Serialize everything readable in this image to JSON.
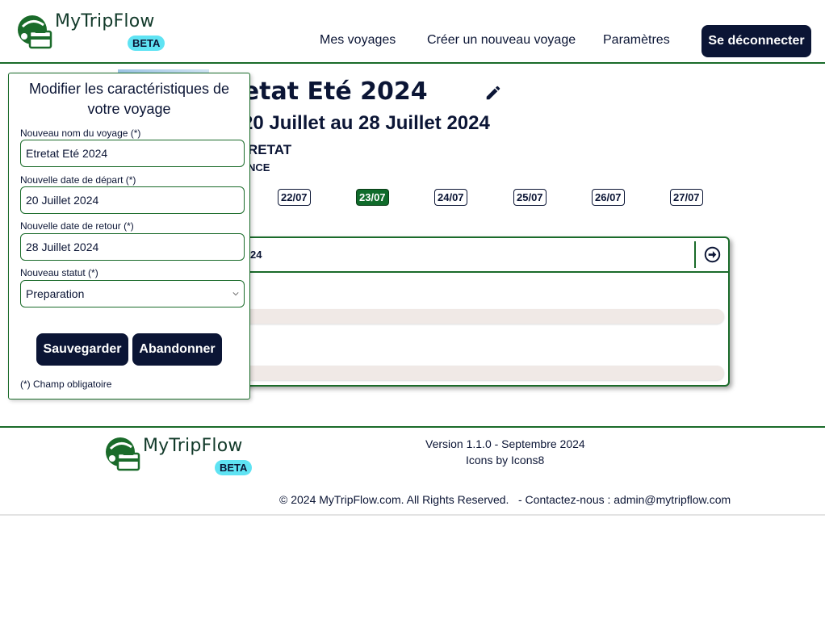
{
  "brand": {
    "name": "MyTripFlow",
    "badge": "BETA"
  },
  "nav": {
    "items": [
      {
        "label": "Mes voyages"
      },
      {
        "label": "Créer un nouveau voyage"
      },
      {
        "label": "Paramètres"
      }
    ],
    "logout_label": "Se déconnecter"
  },
  "trip": {
    "title_partial": "retat Eté 2024",
    "dates_partial": "20 Juillet au 28 Juillet 2024",
    "city_partial": "RETAT",
    "country_partial": "NCE"
  },
  "day_chips": [
    {
      "label": "22/07",
      "active": false
    },
    {
      "label": "23/07",
      "active": true
    },
    {
      "label": "24/07",
      "active": false
    },
    {
      "label": "25/07",
      "active": false
    },
    {
      "label": "26/07",
      "active": false
    },
    {
      "label": "27/07",
      "active": false
    }
  ],
  "day_card": {
    "label_partial": "24"
  },
  "edit_panel": {
    "title": "Modifier les caractéristiques de votre voyage",
    "name_label": "Nouveau nom du voyage (*)",
    "name_value": "Etretat Eté 2024",
    "start_label": "Nouvelle date de départ (*)",
    "start_value": "20 Juillet 2024",
    "end_label": "Nouvelle date de retour (*)",
    "end_value": "28 Juillet 2024",
    "status_label": "Nouveau statut (*)",
    "status_value": "Preparation",
    "save_label": "Sauvegarder",
    "cancel_label": "Abandonner",
    "required_note": "(*) Champ obligatoire"
  },
  "footer": {
    "version": "Version 1.1.0 - Septembre  2024",
    "icons_credit": "Icons by Icons8",
    "copyright": "© 2024 MyTripFlow.com. All Rights Reserved.",
    "contact": "- Contactez-nous : admin@mytripflow.com"
  },
  "colors": {
    "navy": "#0b1535",
    "green": "#1a6b2a",
    "accent_active": "#0f6b2a",
    "beta": "#5fe3f3"
  },
  "icons": [
    "suitcase-logo-icon",
    "pencil-icon",
    "arrow-right-circle-icon",
    "chevron-down-icon"
  ]
}
